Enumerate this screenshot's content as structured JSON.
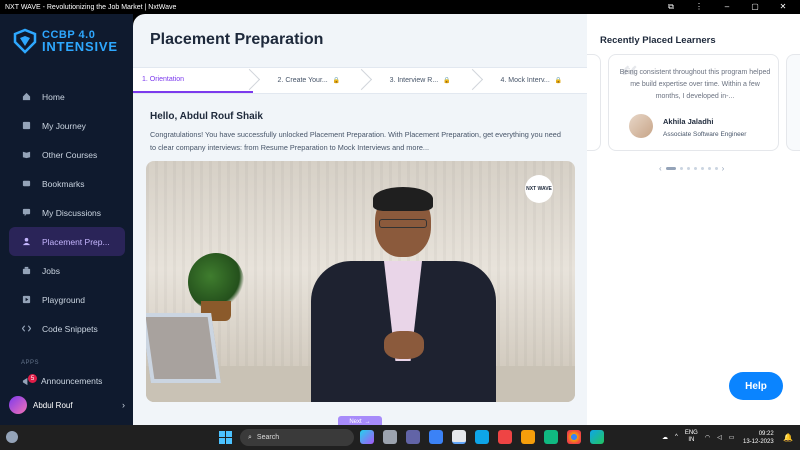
{
  "window": {
    "title": "NXT WAVE - Revolutionizing the Job Market | NxtWave"
  },
  "brand": {
    "line1": "CCBP 4.0",
    "line2": "INTENSIVE"
  },
  "sidebar": {
    "items": [
      {
        "label": "Home",
        "icon": "home-icon"
      },
      {
        "label": "My Journey",
        "icon": "journey-icon"
      },
      {
        "label": "Other Courses",
        "icon": "book-icon"
      },
      {
        "label": "Bookmarks",
        "icon": "bookmark-icon"
      },
      {
        "label": "My Discussions",
        "icon": "discussion-icon"
      },
      {
        "label": "Placement Prep...",
        "icon": "placement-icon",
        "active": true
      },
      {
        "label": "Jobs",
        "icon": "jobs-icon"
      },
      {
        "label": "Playground",
        "icon": "playground-icon"
      },
      {
        "label": "Code Snippets",
        "icon": "code-icon"
      }
    ],
    "apps_label": "APPS",
    "announcements": {
      "label": "Announcements",
      "badge": "5"
    },
    "user": {
      "name": "Abdul Rouf"
    }
  },
  "main": {
    "title": "Placement Preparation",
    "steps": [
      {
        "label": "1. Orientation",
        "locked": false,
        "active": true
      },
      {
        "label": "2. Create Your...",
        "locked": true
      },
      {
        "label": "3. Interview R...",
        "locked": true
      },
      {
        "label": "4. Mock Interv...",
        "locked": true
      }
    ],
    "greeting": "Hello, Abdul Rouf Shaik",
    "description": "Congratulations! You have successfully unlocked Placement Preparation. With Placement Preparation, get everything you need to clear company interviews: from Resume Preparation to Mock Interviews and more...",
    "video_watermark": "NXT WAVE",
    "next_label": "Next"
  },
  "right_panel": {
    "title": "Recently Placed Learners",
    "testimonial": {
      "text": "Being consistent throughout this program helped me build expertise over time. Within a few months, I developed in-...",
      "name": "Akhila Jaladhi",
      "role": "Associate Software Engineer"
    },
    "pager": {
      "count": 7,
      "active_index": 0
    }
  },
  "help_label": "Help",
  "taskbar": {
    "search_label": "Search",
    "lang_line1": "ENG",
    "lang_line2": "IN",
    "time": "09:22",
    "date": "13-12-2023"
  },
  "colors": {
    "accent": "#7c3aed",
    "sidebar_bg": "#0f1a2e",
    "help_bg": "#0a84ff",
    "brand": "#2ea8ff"
  }
}
